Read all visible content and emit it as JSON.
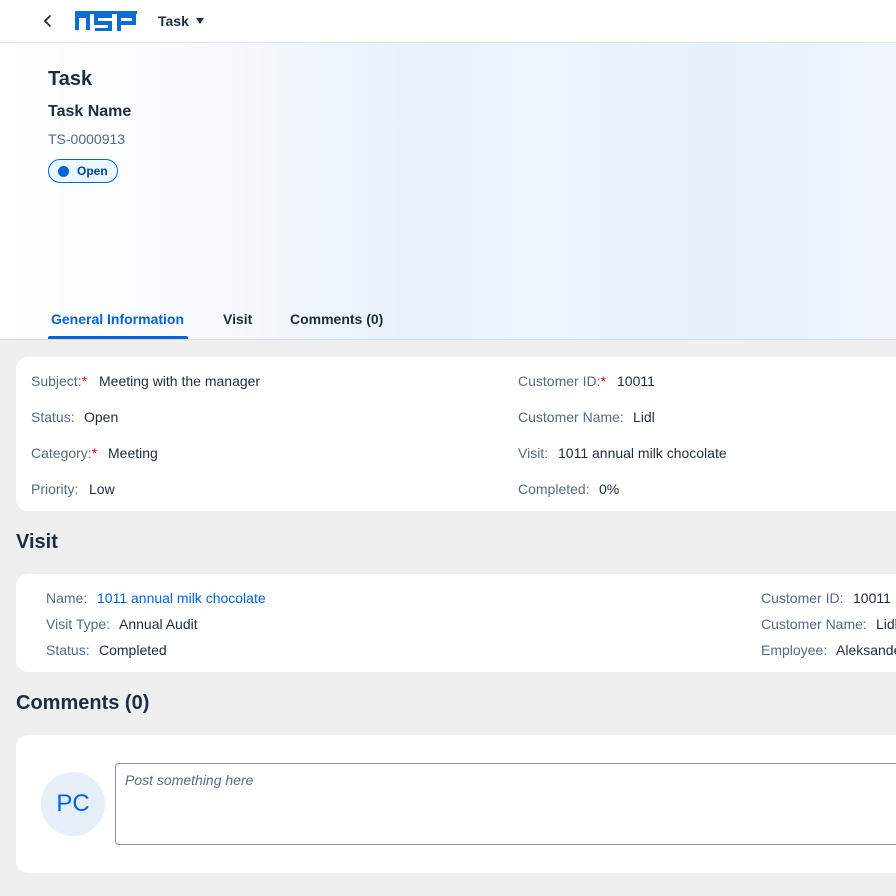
{
  "shellbar": {
    "logo_text": "NSP",
    "app_title": "Task"
  },
  "header": {
    "title": "Task",
    "subtitle": "Task Name",
    "id": "TS-0000913",
    "status": "Open"
  },
  "tabs": [
    {
      "label": "General Information",
      "active": true
    },
    {
      "label": "Visit",
      "active": false
    },
    {
      "label": "Comments (0)",
      "active": false
    }
  ],
  "general": {
    "subject_label": "Subject:",
    "subject_value": "Meeting with the manager",
    "status_label": "Status:",
    "status_value": "Open",
    "category_label": "Category:",
    "category_value": "Meeting",
    "priority_label": "Priority:",
    "priority_value": "Low",
    "customer_id_label": "Customer ID:",
    "customer_id_value": "10011",
    "customer_name_label": "Customer Name:",
    "customer_name_value": "Lidl",
    "visit_label": "Visit:",
    "visit_value": "1011 annual milk chocolate",
    "completed_label": "Completed:",
    "completed_value": "0%"
  },
  "visit_section": {
    "title": "Visit",
    "name_label": "Name:",
    "name_value": "1011 annual milk chocolate",
    "type_label": "Visit Type:",
    "type_value": "Annual Audit",
    "status_label": "Status:",
    "status_value": "Completed",
    "customer_id_label": "Customer ID:",
    "customer_id_value": "10011",
    "customer_name_label": "Customer Name:",
    "customer_name_value": "Lidl",
    "employee_label": "Employee:",
    "employee_value": "Aleksander"
  },
  "comments_section": {
    "title": "Comments (0)",
    "avatar_initials": "PC",
    "input_placeholder": "Post something here"
  },
  "colors": {
    "accent": "#0064d9",
    "required": "#ee0000",
    "background": "#f0eff0"
  }
}
